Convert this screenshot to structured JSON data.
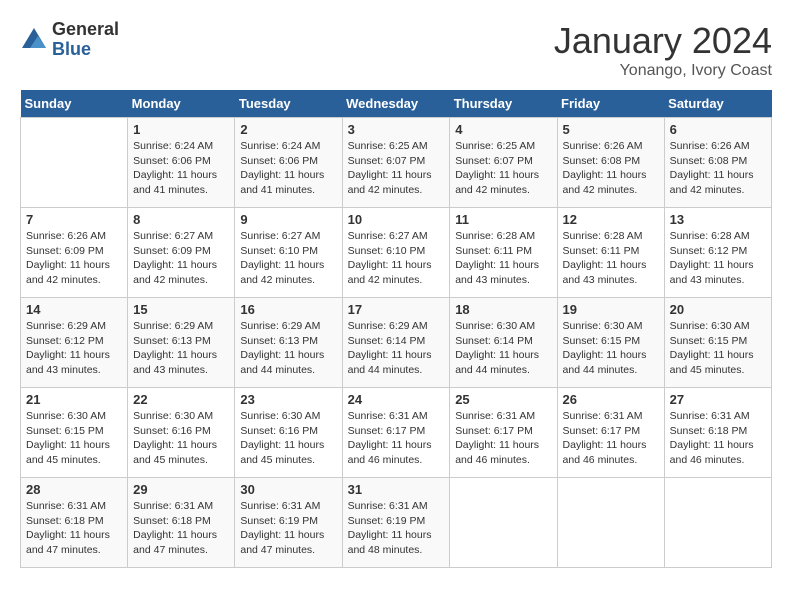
{
  "header": {
    "logo_general": "General",
    "logo_blue": "Blue",
    "month": "January 2024",
    "location": "Yonango, Ivory Coast"
  },
  "days_of_week": [
    "Sunday",
    "Monday",
    "Tuesday",
    "Wednesday",
    "Thursday",
    "Friday",
    "Saturday"
  ],
  "weeks": [
    [
      {
        "day": "",
        "content": ""
      },
      {
        "day": "1",
        "content": "Sunrise: 6:24 AM\nSunset: 6:06 PM\nDaylight: 11 hours\nand 41 minutes."
      },
      {
        "day": "2",
        "content": "Sunrise: 6:24 AM\nSunset: 6:06 PM\nDaylight: 11 hours\nand 41 minutes."
      },
      {
        "day": "3",
        "content": "Sunrise: 6:25 AM\nSunset: 6:07 PM\nDaylight: 11 hours\nand 42 minutes."
      },
      {
        "day": "4",
        "content": "Sunrise: 6:25 AM\nSunset: 6:07 PM\nDaylight: 11 hours\nand 42 minutes."
      },
      {
        "day": "5",
        "content": "Sunrise: 6:26 AM\nSunset: 6:08 PM\nDaylight: 11 hours\nand 42 minutes."
      },
      {
        "day": "6",
        "content": "Sunrise: 6:26 AM\nSunset: 6:08 PM\nDaylight: 11 hours\nand 42 minutes."
      }
    ],
    [
      {
        "day": "7",
        "content": "Sunrise: 6:26 AM\nSunset: 6:09 PM\nDaylight: 11 hours\nand 42 minutes."
      },
      {
        "day": "8",
        "content": "Sunrise: 6:27 AM\nSunset: 6:09 PM\nDaylight: 11 hours\nand 42 minutes."
      },
      {
        "day": "9",
        "content": "Sunrise: 6:27 AM\nSunset: 6:10 PM\nDaylight: 11 hours\nand 42 minutes."
      },
      {
        "day": "10",
        "content": "Sunrise: 6:27 AM\nSunset: 6:10 PM\nDaylight: 11 hours\nand 42 minutes."
      },
      {
        "day": "11",
        "content": "Sunrise: 6:28 AM\nSunset: 6:11 PM\nDaylight: 11 hours\nand 43 minutes."
      },
      {
        "day": "12",
        "content": "Sunrise: 6:28 AM\nSunset: 6:11 PM\nDaylight: 11 hours\nand 43 minutes."
      },
      {
        "day": "13",
        "content": "Sunrise: 6:28 AM\nSunset: 6:12 PM\nDaylight: 11 hours\nand 43 minutes."
      }
    ],
    [
      {
        "day": "14",
        "content": "Sunrise: 6:29 AM\nSunset: 6:12 PM\nDaylight: 11 hours\nand 43 minutes."
      },
      {
        "day": "15",
        "content": "Sunrise: 6:29 AM\nSunset: 6:13 PM\nDaylight: 11 hours\nand 43 minutes."
      },
      {
        "day": "16",
        "content": "Sunrise: 6:29 AM\nSunset: 6:13 PM\nDaylight: 11 hours\nand 44 minutes."
      },
      {
        "day": "17",
        "content": "Sunrise: 6:29 AM\nSunset: 6:14 PM\nDaylight: 11 hours\nand 44 minutes."
      },
      {
        "day": "18",
        "content": "Sunrise: 6:30 AM\nSunset: 6:14 PM\nDaylight: 11 hours\nand 44 minutes."
      },
      {
        "day": "19",
        "content": "Sunrise: 6:30 AM\nSunset: 6:15 PM\nDaylight: 11 hours\nand 44 minutes."
      },
      {
        "day": "20",
        "content": "Sunrise: 6:30 AM\nSunset: 6:15 PM\nDaylight: 11 hours\nand 45 minutes."
      }
    ],
    [
      {
        "day": "21",
        "content": "Sunrise: 6:30 AM\nSunset: 6:15 PM\nDaylight: 11 hours\nand 45 minutes."
      },
      {
        "day": "22",
        "content": "Sunrise: 6:30 AM\nSunset: 6:16 PM\nDaylight: 11 hours\nand 45 minutes."
      },
      {
        "day": "23",
        "content": "Sunrise: 6:30 AM\nSunset: 6:16 PM\nDaylight: 11 hours\nand 45 minutes."
      },
      {
        "day": "24",
        "content": "Sunrise: 6:31 AM\nSunset: 6:17 PM\nDaylight: 11 hours\nand 46 minutes."
      },
      {
        "day": "25",
        "content": "Sunrise: 6:31 AM\nSunset: 6:17 PM\nDaylight: 11 hours\nand 46 minutes."
      },
      {
        "day": "26",
        "content": "Sunrise: 6:31 AM\nSunset: 6:17 PM\nDaylight: 11 hours\nand 46 minutes."
      },
      {
        "day": "27",
        "content": "Sunrise: 6:31 AM\nSunset: 6:18 PM\nDaylight: 11 hours\nand 46 minutes."
      }
    ],
    [
      {
        "day": "28",
        "content": "Sunrise: 6:31 AM\nSunset: 6:18 PM\nDaylight: 11 hours\nand 47 minutes."
      },
      {
        "day": "29",
        "content": "Sunrise: 6:31 AM\nSunset: 6:18 PM\nDaylight: 11 hours\nand 47 minutes."
      },
      {
        "day": "30",
        "content": "Sunrise: 6:31 AM\nSunset: 6:19 PM\nDaylight: 11 hours\nand 47 minutes."
      },
      {
        "day": "31",
        "content": "Sunrise: 6:31 AM\nSunset: 6:19 PM\nDaylight: 11 hours\nand 48 minutes."
      },
      {
        "day": "",
        "content": ""
      },
      {
        "day": "",
        "content": ""
      },
      {
        "day": "",
        "content": ""
      }
    ]
  ]
}
